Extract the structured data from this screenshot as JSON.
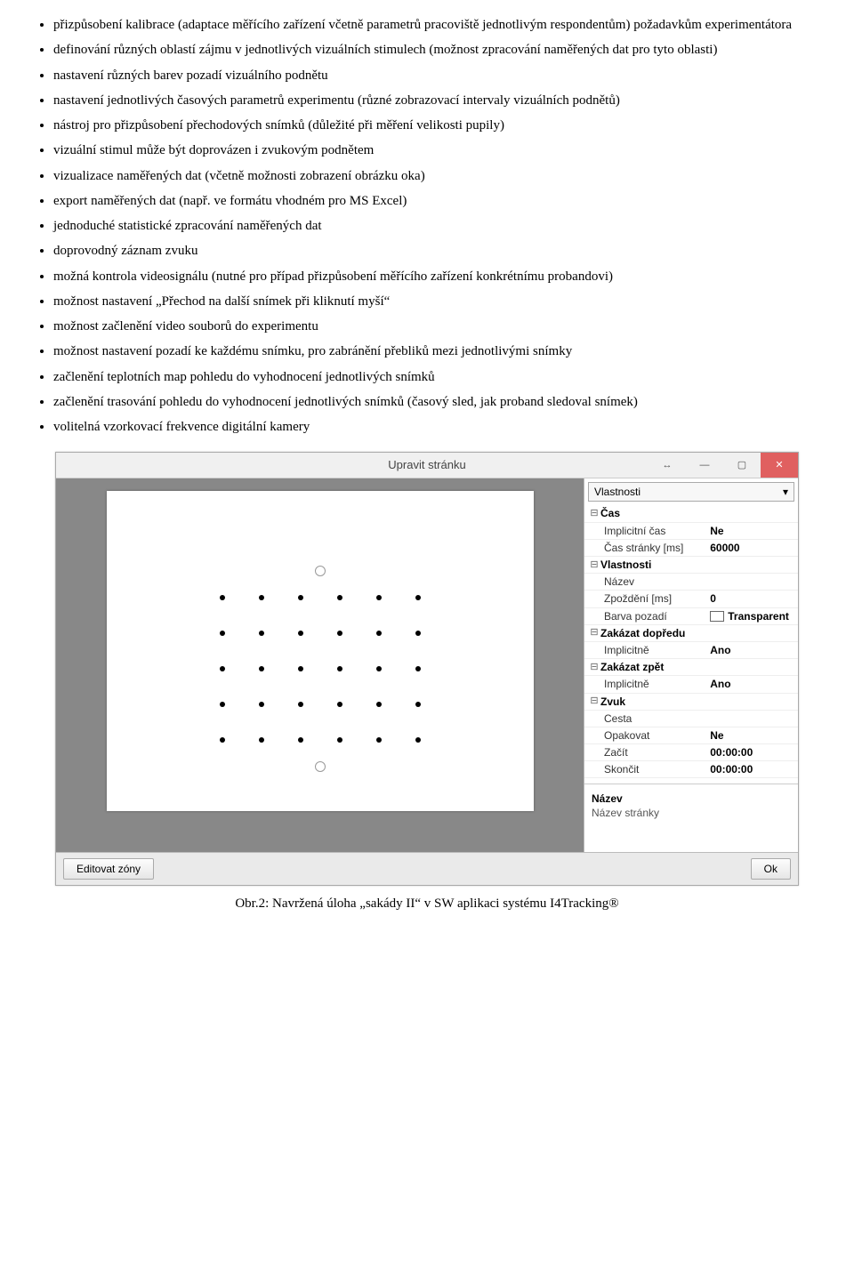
{
  "bullets": [
    "přizpůsobení kalibrace (adaptace měřícího zařízení včetně parametrů pracoviště jednotlivým respondentům) požadavkům experimentátora",
    "definování různých oblastí zájmu v jednotlivých vizuálních stimulech (možnost zpracování naměřených dat pro tyto oblasti)",
    "nastavení různých barev pozadí vizuálního podnětu",
    "nastavení jednotlivých časových parametrů experimentu (různé zobrazovací intervaly vizuálních podnětů)",
    "nástroj pro přizpůsobení přechodových snímků (důležité při měření velikosti pupily)",
    "vizuální stimul může být doprovázen i zvukovým podnětem",
    "vizualizace naměřených dat (včetně možnosti zobrazení obrázku oka)",
    "export naměřených dat (např. ve formátu vhodném pro MS Excel)",
    "jednoduché statistické zpracování naměřených dat",
    "doprovodný záznam zvuku",
    "možná kontrola videosignálu (nutné pro případ přizpůsobení měřícího zařízení konkrétnímu probandovi)",
    "možnost nastavení „Přechod na další snímek při kliknutí myší“",
    "možnost začlenění video souborů do experimentu",
    "možnost nastavení pozadí ke každému snímku, pro zabránění přebliků mezi jednotlivými snímky",
    "začlenění teplotních map pohledu do vyhodnocení jednotlivých snímků",
    "začlenění trasování pohledu do vyhodnocení jednotlivých snímků (časový sled, jak proband sledoval snímek)",
    "volitelná vzorkovací frekvence digitální kamery"
  ],
  "app": {
    "title": "Upravit stránku",
    "dropdown": "Vlastnosti",
    "groups": [
      {
        "label": "Čas",
        "rows": [
          {
            "k": "Implicitní čas",
            "v": "Ne"
          },
          {
            "k": "Čas stránky [ms]",
            "v": "60000"
          }
        ]
      },
      {
        "label": "Vlastnosti",
        "rows": [
          {
            "k": "Název",
            "v": ""
          },
          {
            "k": "Zpoždění [ms]",
            "v": "0"
          },
          {
            "k": "Barva pozadí",
            "v": "Transparent",
            "swatch": true
          }
        ]
      },
      {
        "label": "Zakázat dopředu",
        "rows": [
          {
            "k": "Implicitně",
            "v": "Ano"
          }
        ]
      },
      {
        "label": "Zakázat zpět",
        "rows": [
          {
            "k": "Implicitně",
            "v": "Ano"
          }
        ]
      },
      {
        "label": "Zvuk",
        "rows": [
          {
            "k": "Cesta",
            "v": ""
          },
          {
            "k": "Opakovat",
            "v": "Ne"
          },
          {
            "k": "Začít",
            "v": "00:00:00"
          },
          {
            "k": "Skončit",
            "v": "00:00:00"
          }
        ]
      }
    ],
    "lower": {
      "label": "Název",
      "desc": "Název stránky"
    },
    "buttons": {
      "left": "Editovat zóny",
      "right": "Ok"
    }
  },
  "caption": "Obr.2: Navržená úloha „sakády II“ v SW aplikaci systému I4Tracking®"
}
